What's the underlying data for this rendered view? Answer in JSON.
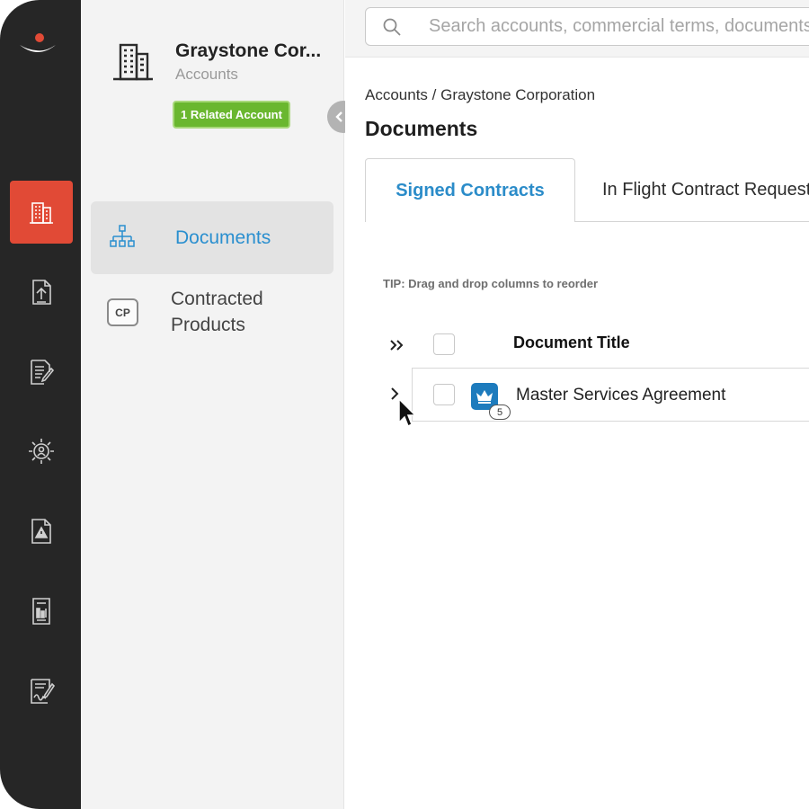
{
  "rail": {
    "items": [
      {
        "name": "accounts",
        "icon": "building-icon",
        "active": true
      },
      {
        "name": "upload",
        "icon": "upload-document-icon",
        "active": false
      },
      {
        "name": "edit",
        "icon": "edit-document-icon",
        "active": false
      },
      {
        "name": "settings",
        "icon": "gear-person-icon",
        "active": false
      },
      {
        "name": "alerts",
        "icon": "warning-document-icon",
        "active": false
      },
      {
        "name": "reports",
        "icon": "report-document-icon",
        "active": false
      },
      {
        "name": "sign",
        "icon": "signature-document-icon",
        "active": false
      }
    ],
    "active_color": "#e14a36"
  },
  "sidebar": {
    "account_name": "Graystone Cor...",
    "account_type": "Accounts",
    "related_badge": "1 Related Account",
    "nav": [
      {
        "label": "Documents",
        "icon": "org-chart-icon",
        "active": true
      },
      {
        "label": "Contracted\nProducts",
        "icon_text": "CP",
        "active": false
      }
    ]
  },
  "search": {
    "placeholder": "Search accounts, commercial terms, documents"
  },
  "main": {
    "breadcrumb": "Accounts / Graystone Corporation",
    "title": "Documents",
    "tabs": [
      {
        "label": "Signed Contracts",
        "active": true
      },
      {
        "label": "In Flight Contract Requests",
        "active": false
      }
    ],
    "tip": "TIP: Drag and drop columns to reorder",
    "table": {
      "column_header": "Document Title",
      "rows": [
        {
          "title": "Master Services Agreement",
          "version_count": "5",
          "icon": "crown-document-icon"
        }
      ]
    }
  },
  "colors": {
    "accent_blue": "#2a8fcf",
    "badge_green": "#6ab72f",
    "rail_bg": "#262626"
  }
}
